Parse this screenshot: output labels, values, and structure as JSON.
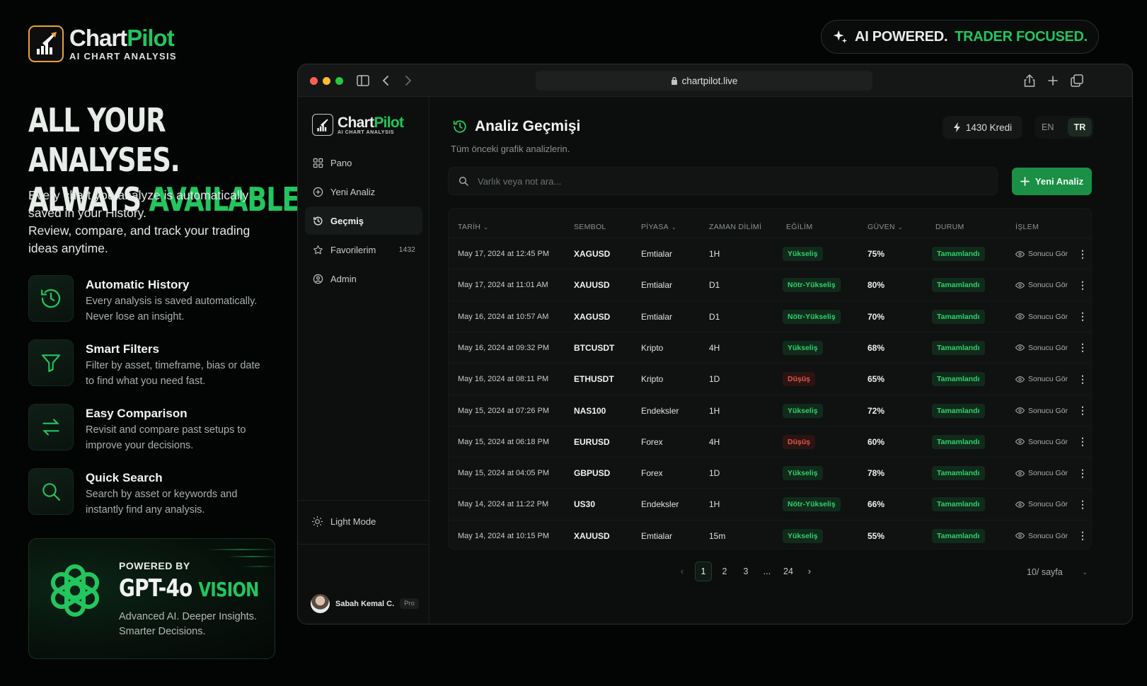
{
  "brand": {
    "name_a": "Chart",
    "name_b": "Pilot",
    "tagline": "AI CHART ANALYSIS"
  },
  "hero": {
    "line1": "ALL YOUR ANALYSES.",
    "line2_a": "ALWAYS ",
    "line2_b": "AVAILABLE.",
    "lead": "Every chart you analyze is automatically saved in your History.\nReview, compare, and track your trading ideas anytime."
  },
  "features": [
    {
      "title": "Automatic History",
      "desc": "Every analysis is saved automatically. Never lose an insight.",
      "icon": "history-icon"
    },
    {
      "title": "Smart Filters",
      "desc": "Filter by asset, timeframe, bias or date to find what you need fast.",
      "icon": "filter-icon"
    },
    {
      "title": "Easy Comparison",
      "desc": "Revisit and compare past setups to improve your decisions.",
      "icon": "swap-arrows-icon"
    },
    {
      "title": "Quick Search",
      "desc": "Search by asset or keywords and instantly find any analysis.",
      "icon": "search-icon"
    }
  ],
  "gpt": {
    "powered_by": "POWERED BY",
    "model": "GPT-4o",
    "vision": "VISION",
    "desc": "Advanced AI. Deeper Insights. Smarter Decisions."
  },
  "badge": {
    "text_a": "AI POWERED.",
    "text_b": "TRADER FOCUSED."
  },
  "browser": {
    "url": "chartpilot.live"
  },
  "sidebar": {
    "brand_a": "Chart",
    "brand_b": "Pilot",
    "tagline": "AI CHART ANALYSIS",
    "items": [
      {
        "label": "Pano",
        "icon": "dashboard-icon"
      },
      {
        "label": "Yeni Analiz",
        "icon": "plus-circle-icon"
      },
      {
        "label": "Geçmiş",
        "icon": "history-icon",
        "active": true
      },
      {
        "label": "Favorilerim",
        "icon": "star-icon",
        "count": "1432"
      },
      {
        "label": "Admin",
        "icon": "admin-icon"
      }
    ],
    "light_mode": "Light Mode",
    "user": {
      "name": "Sabah Kemal C.",
      "plan": "Pro"
    }
  },
  "page": {
    "title": "Analiz Geçmişi",
    "subtitle": "Tüm önceki grafik analizlerin.",
    "credits": "1430 Kredi",
    "lang": {
      "en": "EN",
      "tr": "TR",
      "selected": "TR"
    },
    "search_placeholder": "Varlık veya not ara...",
    "new_button": "Yeni Analiz"
  },
  "table": {
    "columns": [
      "TARİH",
      "SEMBOL",
      "PİYASA",
      "ZAMAN DİLİMİ",
      "EĞİLİM",
      "GÜVEN",
      "DURUM",
      "İŞLEM"
    ],
    "rows": [
      {
        "date": "May 17, 2024 at 12:45 PM",
        "symbol": "XAGUSD",
        "market": "Emtialar",
        "tf": "1H",
        "bias": "Yükseliş",
        "bias_type": "up",
        "conf": "75%",
        "status": "Tamamlandı",
        "action": "Sonucu Gör"
      },
      {
        "date": "May 17, 2024 at 11:01 AM",
        "symbol": "XAUUSD",
        "market": "Emtialar",
        "tf": "D1",
        "bias": "Nötr-Yükseliş",
        "bias_type": "mid",
        "conf": "80%",
        "status": "Tamamlandı",
        "action": "Sonucu Gör"
      },
      {
        "date": "May 16, 2024 at 10:57 AM",
        "symbol": "XAGUSD",
        "market": "Emtialar",
        "tf": "D1",
        "bias": "Nötr-Yükseliş",
        "bias_type": "mid",
        "conf": "70%",
        "status": "Tamamlandı",
        "action": "Sonucu Gör"
      },
      {
        "date": "May 16, 2024 at 09:32 PM",
        "symbol": "BTCUSDT",
        "market": "Kripto",
        "tf": "4H",
        "bias": "Yükseliş",
        "bias_type": "up",
        "conf": "68%",
        "status": "Tamamlandı",
        "action": "Sonucu Gör"
      },
      {
        "date": "May 16, 2024 at 08:11 PM",
        "symbol": "ETHUSDT",
        "market": "Kripto",
        "tf": "1D",
        "bias": "Düşüş",
        "bias_type": "down",
        "conf": "65%",
        "status": "Tamamlandı",
        "action": "Sonucu Gör"
      },
      {
        "date": "May 15, 2024 at 07:26 PM",
        "symbol": "NAS100",
        "market": "Endeksler",
        "tf": "1H",
        "bias": "Yükseliş",
        "bias_type": "up",
        "conf": "72%",
        "status": "Tamamlandı",
        "action": "Sonucu Gör"
      },
      {
        "date": "May 15, 2024 at 06:18 PM",
        "symbol": "EURUSD",
        "market": "Forex",
        "tf": "4H",
        "bias": "Düşüş",
        "bias_type": "down",
        "conf": "60%",
        "status": "Tamamlandı",
        "action": "Sonucu Gör"
      },
      {
        "date": "May 15, 2024 at 04:05 PM",
        "symbol": "GBPUSD",
        "market": "Forex",
        "tf": "1D",
        "bias": "Yükseliş",
        "bias_type": "up",
        "conf": "78%",
        "status": "Tamamlandı",
        "action": "Sonucu Gör"
      },
      {
        "date": "May 14, 2024 at 11:22 PM",
        "symbol": "US30",
        "market": "Endeksler",
        "tf": "1H",
        "bias": "Nötr-Yükseliş",
        "bias_type": "mid",
        "conf": "66%",
        "status": "Tamamlandı",
        "action": "Sonucu Gör"
      },
      {
        "date": "May 14, 2024 at 10:15 PM",
        "symbol": "XAUUSD",
        "market": "Emtialar",
        "tf": "15m",
        "bias": "Yükseliş",
        "bias_type": "up",
        "conf": "55%",
        "status": "Tamamlandı",
        "action": "Sonucu Gör"
      }
    ]
  },
  "pagination": {
    "pages": [
      "1",
      "2",
      "3",
      "...",
      "24"
    ],
    "current": "1",
    "per_page": "10/ sayfa"
  },
  "colors": {
    "accent": "#22c55e",
    "button": "#1a8f45",
    "danger": "#e0564a",
    "background": "#030504"
  }
}
